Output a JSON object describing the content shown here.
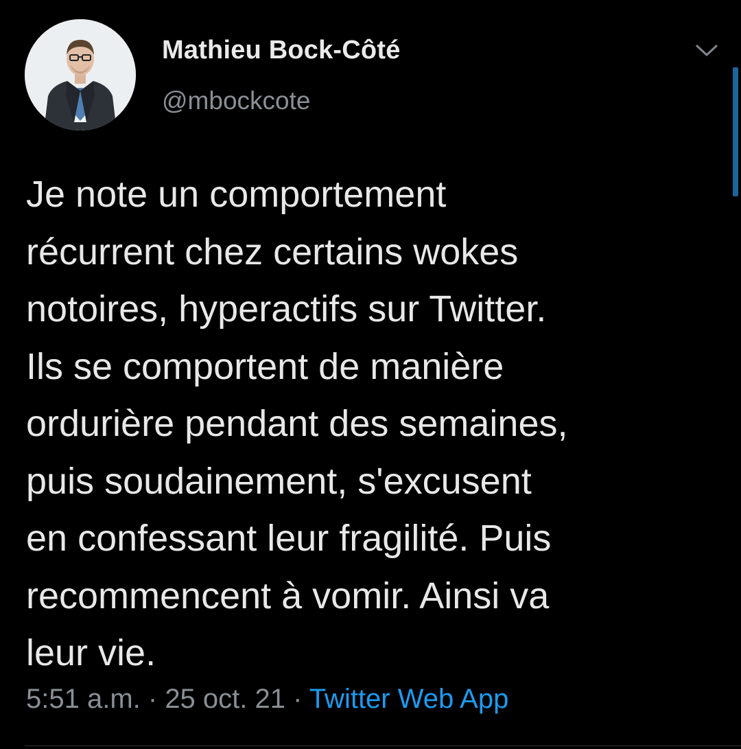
{
  "author": {
    "display_name": "Mathieu Bock-Côté",
    "handle": "@mbockcote",
    "avatar_icon": "profile-photo-man-in-suit"
  },
  "tweet": {
    "lines": [
      "Je note un comportement",
      "récurrent chez certains wokes",
      "notoires, hyperactifs sur Twitter.",
      "Ils se comportent de manière",
      "ordurière pendant des semaines,",
      "puis soudainement, s'excusent",
      "en confessant leur fragilité. Puis",
      "recommencent à vomir. Ainsi va",
      "leur vie."
    ]
  },
  "meta": {
    "time": "5:51 a.m.",
    "separator": " · ",
    "date": "25 oct. 21",
    "source": "Twitter Web App"
  },
  "menu": {
    "icon": "chevron-down-icon"
  },
  "colors": {
    "background": "#000000",
    "text": "#e8e8e8",
    "secondary_text": "#8a8f95",
    "link": "#1d9bf0"
  }
}
